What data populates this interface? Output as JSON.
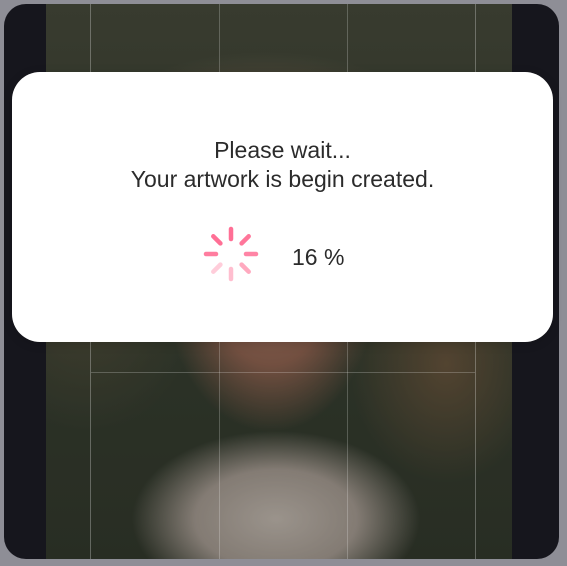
{
  "modal": {
    "line1": "Please wait...",
    "line2": "Your artwork is begin created.",
    "progress_text": "16 %",
    "progress_percent": 16
  },
  "spinner": {
    "icon": "loading-spinner-icon",
    "color": "#ff6f95"
  },
  "background": {
    "image": "portrait-photo"
  }
}
